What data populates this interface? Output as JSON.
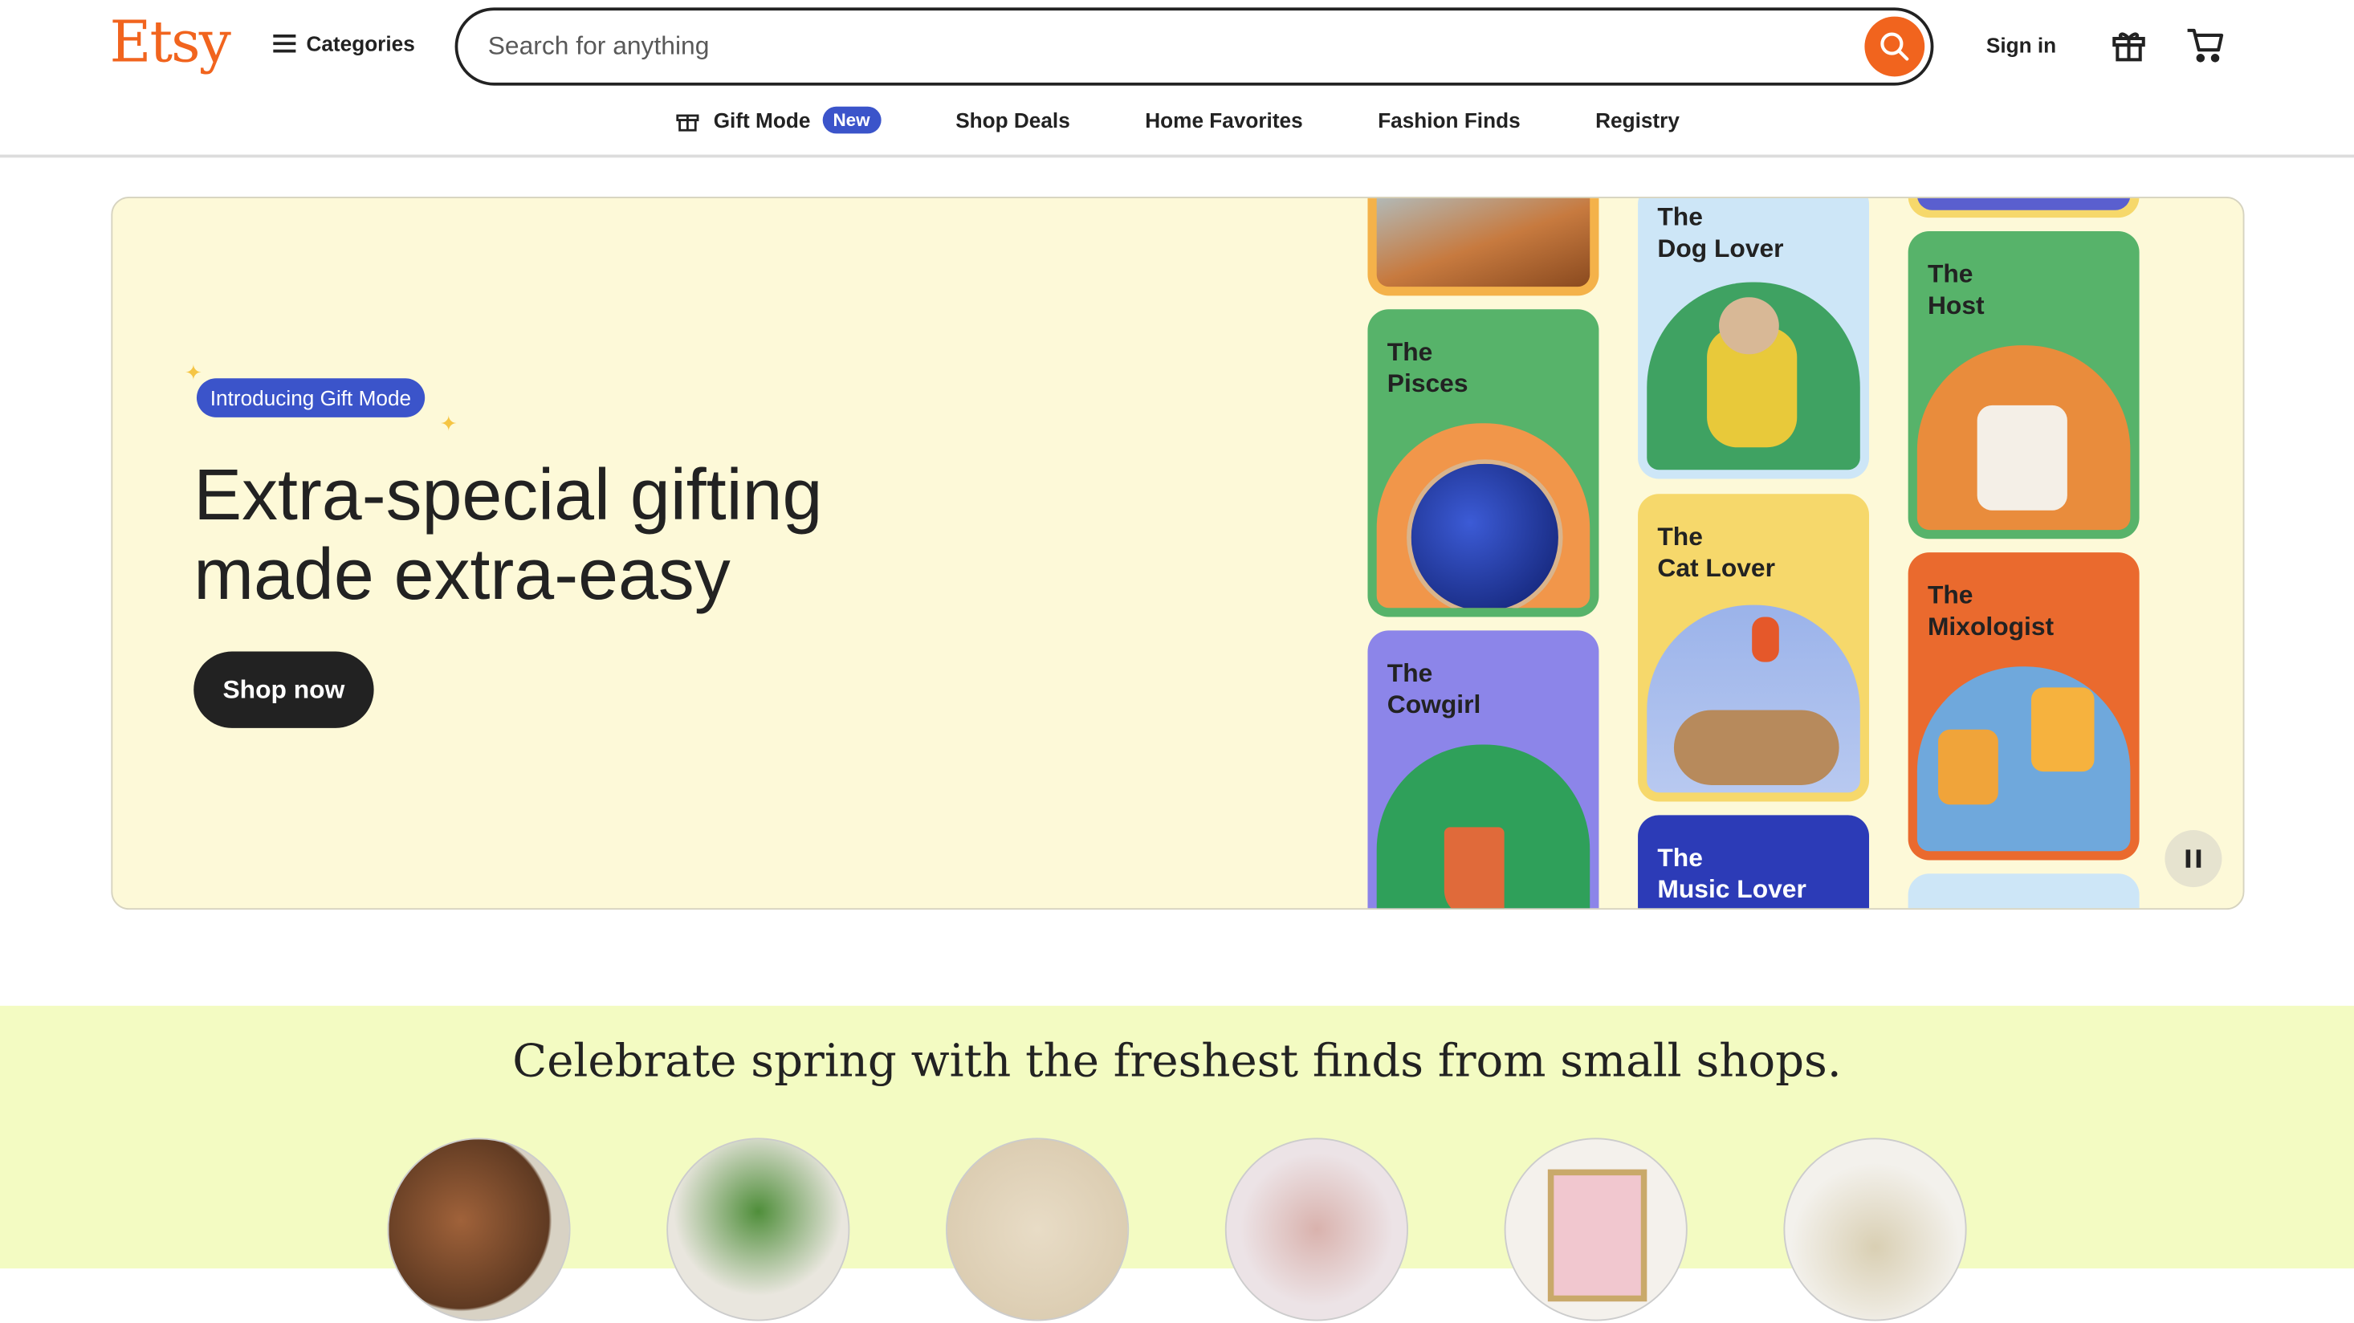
{
  "header": {
    "logo": "Etsy",
    "categories_label": "Categories",
    "search_placeholder": "Search for anything",
    "signin_label": "Sign in"
  },
  "nav": {
    "items": [
      {
        "label": "Gift Mode",
        "badge": "New"
      },
      {
        "label": "Shop Deals"
      },
      {
        "label": "Home Favorites"
      },
      {
        "label": "Fashion Finds"
      },
      {
        "label": "Registry"
      }
    ]
  },
  "hero": {
    "badge": "Introducing Gift Mode",
    "headline_line1": "Extra-special gifting",
    "headline_line2": "made extra-easy",
    "cta": "Shop now",
    "tiles": [
      {
        "title": "The\nPisces",
        "color": "#57B36A"
      },
      {
        "title": "The\nCowgirl",
        "color": "#8C85E9"
      },
      {
        "title": "The\nDog Lover",
        "color": "#CDE6F7"
      },
      {
        "title": "The\nCat Lover",
        "color": "#F6D86B"
      },
      {
        "title": "The\nMusic Lover",
        "color": "#2C3BB7"
      },
      {
        "title": "The\nHost",
        "color": "#57B36A"
      },
      {
        "title": "The\nMixologist",
        "color": "#EA6A2E"
      }
    ]
  },
  "spring": {
    "title": "Celebrate spring with the freshest finds from small shops.",
    "items": [
      "leather-goods",
      "plant",
      "baby-clothing",
      "plush-bunny",
      "wall-art",
      "bag"
    ]
  },
  "colors": {
    "brand": "#F1641E",
    "accent": "#3B54CA",
    "hero_bg": "#FDF9D8",
    "spring_bg": "#F3FBC2"
  }
}
